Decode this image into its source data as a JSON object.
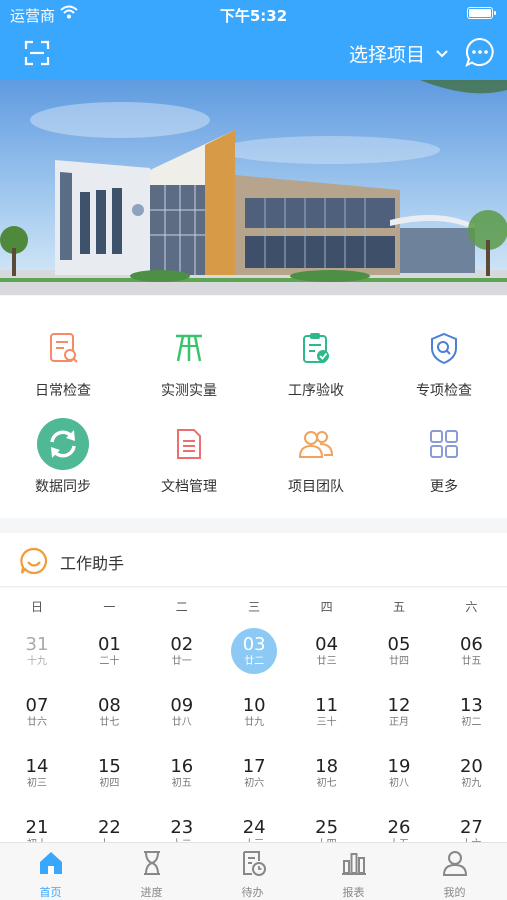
{
  "status_bar": {
    "carrier": "运营商",
    "time": "下午5:32",
    "battery_level": 1.0
  },
  "header": {
    "project_select": "选择项目"
  },
  "menu": [
    {
      "label": "日常检查",
      "icon": "daily-check-icon",
      "color": "#f58a64"
    },
    {
      "label": "实测实量",
      "icon": "measure-icon",
      "color": "#39c46b"
    },
    {
      "label": "工序验收",
      "icon": "acceptance-icon",
      "color": "#2fb98a"
    },
    {
      "label": "专项检查",
      "icon": "special-check-icon",
      "color": "#4e7fd6"
    },
    {
      "label": "数据同步",
      "icon": "sync-icon",
      "color": "#4fb895"
    },
    {
      "label": "文档管理",
      "icon": "document-icon",
      "color": "#ef6d6d"
    },
    {
      "label": "项目团队",
      "icon": "team-icon",
      "color": "#f1a25c"
    },
    {
      "label": "更多",
      "icon": "more-grid-icon",
      "color": "#8a9bd9"
    }
  ],
  "assistant": {
    "title": "工作助手"
  },
  "calendar": {
    "weekdays": [
      "日",
      "一",
      "二",
      "三",
      "四",
      "五",
      "六"
    ],
    "weeks": [
      [
        {
          "d": "31",
          "l": "十九",
          "other": true
        },
        {
          "d": "01",
          "l": "二十"
        },
        {
          "d": "02",
          "l": "廿一"
        },
        {
          "d": "03",
          "l": "廿二",
          "today": true
        },
        {
          "d": "04",
          "l": "廿三"
        },
        {
          "d": "05",
          "l": "廿四"
        },
        {
          "d": "06",
          "l": "廿五"
        }
      ],
      [
        {
          "d": "07",
          "l": "廿六"
        },
        {
          "d": "08",
          "l": "廿七"
        },
        {
          "d": "09",
          "l": "廿八"
        },
        {
          "d": "10",
          "l": "廿九"
        },
        {
          "d": "11",
          "l": "三十"
        },
        {
          "d": "12",
          "l": "正月"
        },
        {
          "d": "13",
          "l": "初二"
        }
      ],
      [
        {
          "d": "14",
          "l": "初三"
        },
        {
          "d": "15",
          "l": "初四"
        },
        {
          "d": "16",
          "l": "初五"
        },
        {
          "d": "17",
          "l": "初六"
        },
        {
          "d": "18",
          "l": "初七"
        },
        {
          "d": "19",
          "l": "初八"
        },
        {
          "d": "20",
          "l": "初九"
        }
      ],
      [
        {
          "d": "21",
          "l": "初十"
        },
        {
          "d": "22",
          "l": "十一"
        },
        {
          "d": "23",
          "l": "十二"
        },
        {
          "d": "24",
          "l": "十三"
        },
        {
          "d": "25",
          "l": "十四"
        },
        {
          "d": "26",
          "l": "十五"
        },
        {
          "d": "27",
          "l": "十六"
        }
      ]
    ]
  },
  "tabbar": [
    {
      "label": "首页",
      "icon": "home-icon",
      "active": true
    },
    {
      "label": "进度",
      "icon": "hourglass-icon"
    },
    {
      "label": "待办",
      "icon": "todo-icon"
    },
    {
      "label": "报表",
      "icon": "report-icon"
    },
    {
      "label": "我的",
      "icon": "profile-icon"
    }
  ],
  "colors": {
    "brand": "#3aa7ff",
    "today": "#8ccaf5",
    "tab_active": "#3aa7ff"
  }
}
